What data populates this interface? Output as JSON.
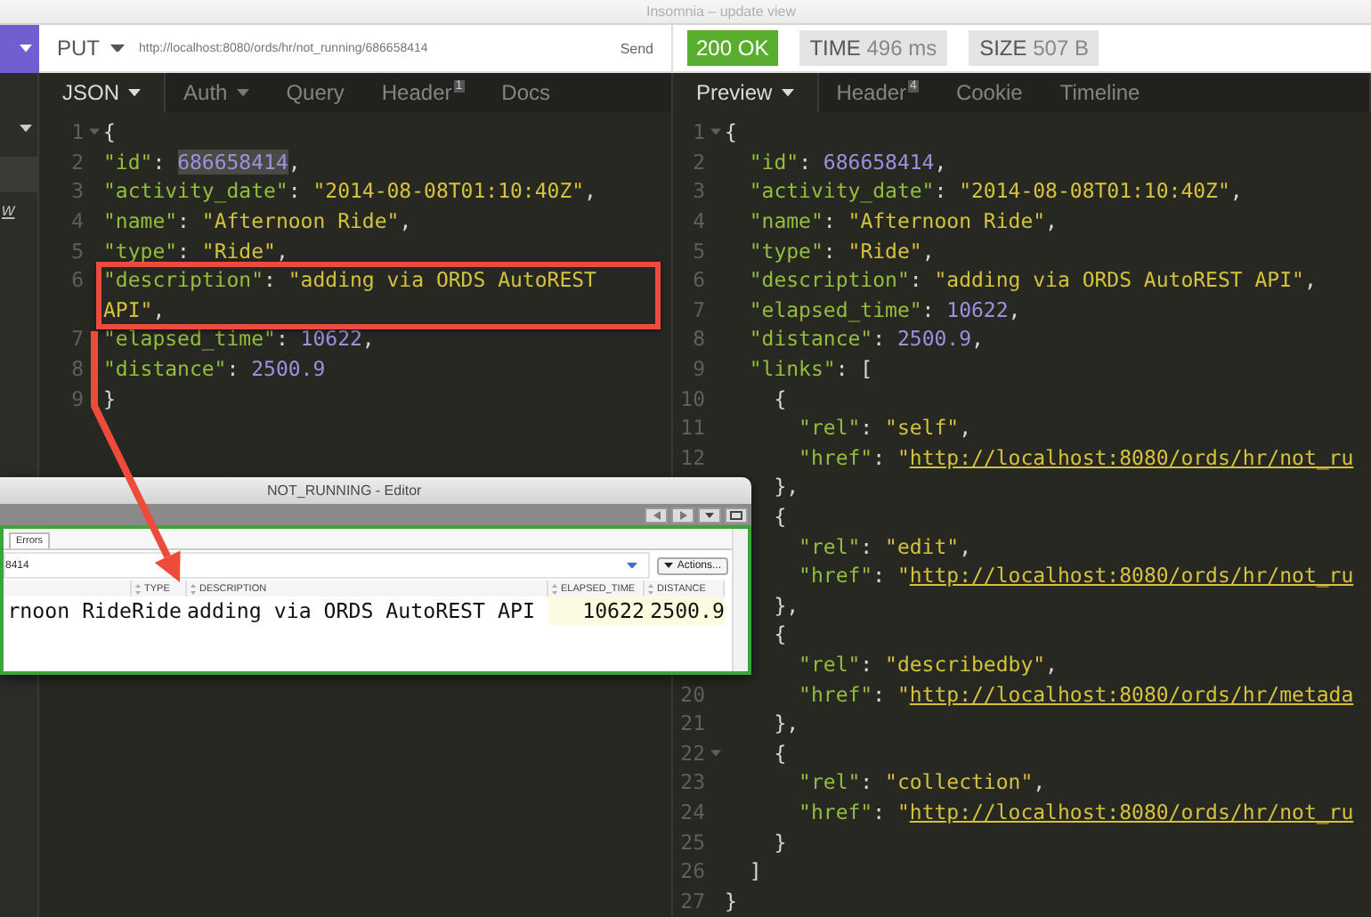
{
  "window": {
    "title": "Insomnia – update view"
  },
  "sidebar": {
    "link_text": "w"
  },
  "request": {
    "method": "PUT",
    "url": "http://localhost:8080/ords/hr/not_running/686658414",
    "send_label": "Send"
  },
  "response": {
    "status": "200 OK",
    "metrics": [
      {
        "label": "TIME",
        "value": "496 ms"
      },
      {
        "label": "SIZE",
        "value": "507 B"
      }
    ]
  },
  "request_tabs": [
    {
      "label": "JSON",
      "dropdown": true,
      "selected": true
    },
    {
      "label": "Auth",
      "dropdown": true,
      "selected": false
    },
    {
      "label": "Query",
      "dropdown": false,
      "selected": false
    },
    {
      "label": "Header",
      "badge": "1",
      "dropdown": false,
      "selected": false
    },
    {
      "label": "Docs",
      "dropdown": false,
      "selected": false
    }
  ],
  "response_tabs": [
    {
      "label": "Preview",
      "dropdown": true,
      "selected": true
    },
    {
      "label": "Header",
      "badge": "4",
      "dropdown": false,
      "selected": false
    },
    {
      "label": "Cookie",
      "dropdown": false,
      "selected": false
    },
    {
      "label": "Timeline",
      "dropdown": false,
      "selected": false
    }
  ],
  "request_body": [
    {
      "number": "1",
      "fold": true,
      "tokens": [
        {
          "kind": "punct",
          "text": "{"
        }
      ]
    },
    {
      "number": "2",
      "tokens": [
        {
          "kind": "key",
          "text": "\"id\""
        },
        {
          "kind": "punct",
          "text": ": "
        },
        {
          "kind": "num-selected",
          "text": "686658414"
        },
        {
          "kind": "punct",
          "text": ","
        }
      ]
    },
    {
      "number": "3",
      "tokens": [
        {
          "kind": "key",
          "text": "\"activity_date\""
        },
        {
          "kind": "punct",
          "text": ": "
        },
        {
          "kind": "str",
          "text": "\"2014-08-08T01:10:40Z\""
        },
        {
          "kind": "punct",
          "text": ","
        }
      ]
    },
    {
      "number": "4",
      "tokens": [
        {
          "kind": "key",
          "text": "\"name\""
        },
        {
          "kind": "punct",
          "text": ": "
        },
        {
          "kind": "str",
          "text": "\"Afternoon Ride\""
        },
        {
          "kind": "punct",
          "text": ","
        }
      ]
    },
    {
      "number": "5",
      "tokens": [
        {
          "kind": "key",
          "text": "\"type\""
        },
        {
          "kind": "punct",
          "text": ": "
        },
        {
          "kind": "str",
          "text": "\"Ride\""
        },
        {
          "kind": "punct",
          "text": ","
        }
      ]
    },
    {
      "number": "6",
      "boxed": true,
      "tokens": [
        {
          "kind": "key",
          "text": "\"description\""
        },
        {
          "kind": "punct",
          "text": ": "
        },
        {
          "kind": "str",
          "text": "\"adding via ORDS AutoREST"
        }
      ]
    },
    {
      "boxed": true,
      "tokens": [
        {
          "kind": "str",
          "text": "API\""
        },
        {
          "kind": "punct",
          "text": ","
        }
      ]
    },
    {
      "number": "7",
      "tokens": [
        {
          "kind": "key",
          "text": "\"elapsed_time\""
        },
        {
          "kind": "punct",
          "text": ": "
        },
        {
          "kind": "num",
          "text": "10622"
        },
        {
          "kind": "punct",
          "text": ","
        }
      ]
    },
    {
      "number": "8",
      "tokens": [
        {
          "kind": "key",
          "text": "\"distance\""
        },
        {
          "kind": "punct",
          "text": ": "
        },
        {
          "kind": "num",
          "text": "2500.9"
        }
      ]
    },
    {
      "number": "9",
      "tokens": [
        {
          "kind": "punct",
          "text": "}"
        }
      ]
    }
  ],
  "response_body": [
    {
      "number": "1",
      "fold": true,
      "tokens": [
        {
          "kind": "punct",
          "text": "{"
        }
      ]
    },
    {
      "number": "2",
      "tokens": [
        {
          "kind": "key",
          "text": "  \"id\""
        },
        {
          "kind": "punct",
          "text": ": "
        },
        {
          "kind": "num",
          "text": "686658414"
        },
        {
          "kind": "punct",
          "text": ","
        }
      ]
    },
    {
      "number": "3",
      "tokens": [
        {
          "kind": "key",
          "text": "  \"activity_date\""
        },
        {
          "kind": "punct",
          "text": ": "
        },
        {
          "kind": "str",
          "text": "\"2014-08-08T01:10:40Z\""
        },
        {
          "kind": "punct",
          "text": ","
        }
      ]
    },
    {
      "number": "4",
      "tokens": [
        {
          "kind": "key",
          "text": "  \"name\""
        },
        {
          "kind": "punct",
          "text": ": "
        },
        {
          "kind": "str",
          "text": "\"Afternoon Ride\""
        },
        {
          "kind": "punct",
          "text": ","
        }
      ]
    },
    {
      "number": "5",
      "tokens": [
        {
          "kind": "key",
          "text": "  \"type\""
        },
        {
          "kind": "punct",
          "text": ": "
        },
        {
          "kind": "str",
          "text": "\"Ride\""
        },
        {
          "kind": "punct",
          "text": ","
        }
      ]
    },
    {
      "number": "6",
      "tokens": [
        {
          "kind": "key",
          "text": "  \"description\""
        },
        {
          "kind": "punct",
          "text": ": "
        },
        {
          "kind": "str",
          "text": "\"adding via ORDS AutoREST API\""
        },
        {
          "kind": "punct",
          "text": ","
        }
      ]
    },
    {
      "number": "7",
      "tokens": [
        {
          "kind": "key",
          "text": "  \"elapsed_time\""
        },
        {
          "kind": "punct",
          "text": ": "
        },
        {
          "kind": "num",
          "text": "10622"
        },
        {
          "kind": "punct",
          "text": ","
        }
      ]
    },
    {
      "number": "8",
      "tokens": [
        {
          "kind": "key",
          "text": "  \"distance\""
        },
        {
          "kind": "punct",
          "text": ": "
        },
        {
          "kind": "num",
          "text": "2500.9"
        },
        {
          "kind": "punct",
          "text": ","
        }
      ]
    },
    {
      "number": "9",
      "tokens": [
        {
          "kind": "key",
          "text": "  \"links\""
        },
        {
          "kind": "punct",
          "text": ": ["
        }
      ]
    },
    {
      "number": "10",
      "tokens": [
        {
          "kind": "punct",
          "text": "    {"
        }
      ]
    },
    {
      "number": "11",
      "tokens": [
        {
          "kind": "key",
          "text": "      \"rel\""
        },
        {
          "kind": "punct",
          "text": ": "
        },
        {
          "kind": "str",
          "text": "\"self\""
        },
        {
          "kind": "punct",
          "text": ","
        }
      ]
    },
    {
      "number": "12",
      "tokens": [
        {
          "kind": "key",
          "text": "      \"href\""
        },
        {
          "kind": "punct",
          "text": ": "
        },
        {
          "kind": "str",
          "text": "\""
        },
        {
          "kind": "link",
          "text": "http://localhost:8080/ords/hr/not_ru"
        }
      ]
    },
    {
      "tokens": [
        {
          "kind": "punct",
          "text": "    },"
        }
      ]
    },
    {
      "tokens": [
        {
          "kind": "punct",
          "text": "    {"
        }
      ]
    },
    {
      "tokens": [
        {
          "kind": "key",
          "text": "      \"rel\""
        },
        {
          "kind": "punct",
          "text": ": "
        },
        {
          "kind": "str",
          "text": "\"edit\""
        },
        {
          "kind": "punct",
          "text": ","
        }
      ]
    },
    {
      "tokens": [
        {
          "kind": "key",
          "text": "      \"href\""
        },
        {
          "kind": "punct",
          "text": ": "
        },
        {
          "kind": "str",
          "text": "\""
        },
        {
          "kind": "link",
          "text": "http://localhost:8080/ords/hr/not_ru"
        }
      ]
    },
    {
      "tokens": [
        {
          "kind": "punct",
          "text": "    },"
        }
      ]
    },
    {
      "tokens": [
        {
          "kind": "punct",
          "text": "    {"
        }
      ]
    },
    {
      "tokens": [
        {
          "kind": "key",
          "text": "      \"rel\""
        },
        {
          "kind": "punct",
          "text": ": "
        },
        {
          "kind": "str",
          "text": "\"describedby\""
        },
        {
          "kind": "punct",
          "text": ","
        }
      ]
    },
    {
      "number": "20",
      "tokens": [
        {
          "kind": "key",
          "text": "      \"href\""
        },
        {
          "kind": "punct",
          "text": ": "
        },
        {
          "kind": "str",
          "text": "\""
        },
        {
          "kind": "link",
          "text": "http://localhost:8080/ords/hr/metada"
        }
      ]
    },
    {
      "number": "21",
      "tokens": [
        {
          "kind": "punct",
          "text": "    },"
        }
      ]
    },
    {
      "number": "22",
      "fold": true,
      "tokens": [
        {
          "kind": "punct",
          "text": "    {"
        }
      ]
    },
    {
      "number": "23",
      "tokens": [
        {
          "kind": "key",
          "text": "      \"rel\""
        },
        {
          "kind": "punct",
          "text": ": "
        },
        {
          "kind": "str",
          "text": "\"collection\""
        },
        {
          "kind": "punct",
          "text": ","
        }
      ]
    },
    {
      "number": "24",
      "tokens": [
        {
          "kind": "key",
          "text": "      \"href\""
        },
        {
          "kind": "punct",
          "text": ": "
        },
        {
          "kind": "str",
          "text": "\""
        },
        {
          "kind": "link",
          "text": "http://localhost:8080/ords/hr/not_ru"
        }
      ]
    },
    {
      "number": "25",
      "tokens": [
        {
          "kind": "punct",
          "text": "    }"
        }
      ]
    },
    {
      "number": "26",
      "tokens": [
        {
          "kind": "punct",
          "text": "  ]"
        }
      ]
    },
    {
      "number": "27",
      "tokens": [
        {
          "kind": "punct",
          "text": "}"
        }
      ]
    }
  ],
  "editor_window": {
    "title": "NOT_RUNNING - Editor",
    "tab": "Errors",
    "field_value": "8414",
    "actions_label": "Actions...",
    "columns": [
      {
        "numeric": false
      },
      {
        "label": "TYPE",
        "numeric": false
      },
      {
        "label": "DESCRIPTION",
        "numeric": false
      },
      {
        "label": "ELAPSED_TIME",
        "numeric": true
      },
      {
        "label": "DISTANCE",
        "numeric": true
      }
    ],
    "row": [
      "rnoon Ride",
      "Ride",
      "adding via ORDS AutoREST API",
      "10622",
      "2500.9"
    ]
  }
}
